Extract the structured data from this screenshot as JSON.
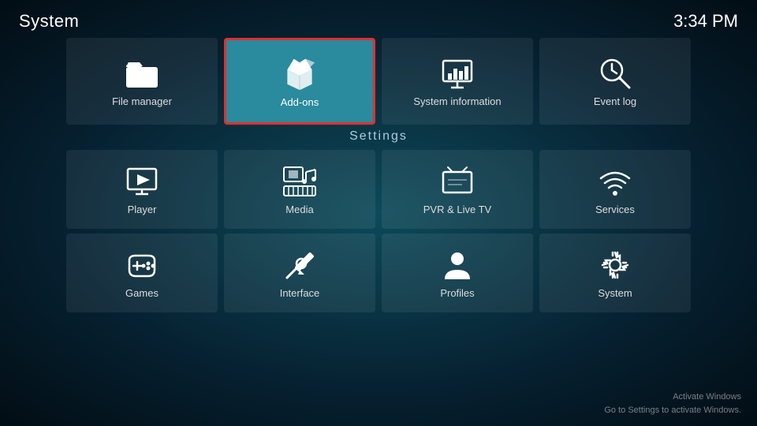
{
  "header": {
    "title": "System",
    "time": "3:34 PM"
  },
  "top_tiles": [
    {
      "id": "file-manager",
      "label": "File manager",
      "icon": "folder",
      "selected": false
    },
    {
      "id": "add-ons",
      "label": "Add-ons",
      "icon": "box",
      "selected": true
    },
    {
      "id": "system-information",
      "label": "System information",
      "icon": "presentation",
      "selected": false
    },
    {
      "id": "event-log",
      "label": "Event log",
      "icon": "clock-search",
      "selected": false
    }
  ],
  "settings_label": "Settings",
  "settings_rows": [
    [
      {
        "id": "player",
        "label": "Player",
        "icon": "monitor-play"
      },
      {
        "id": "media",
        "label": "Media",
        "icon": "media"
      },
      {
        "id": "pvr-live-tv",
        "label": "PVR & Live TV",
        "icon": "tv"
      },
      {
        "id": "services",
        "label": "Services",
        "icon": "wifi"
      }
    ],
    [
      {
        "id": "games",
        "label": "Games",
        "icon": "gamepad"
      },
      {
        "id": "interface",
        "label": "Interface",
        "icon": "wrench-pencil"
      },
      {
        "id": "profiles",
        "label": "Profiles",
        "icon": "person"
      },
      {
        "id": "system",
        "label": "System",
        "icon": "gear-wrench"
      }
    ]
  ],
  "watermark": {
    "line1": "Activate Windows",
    "line2": "Go to Settings to activate Windows."
  }
}
